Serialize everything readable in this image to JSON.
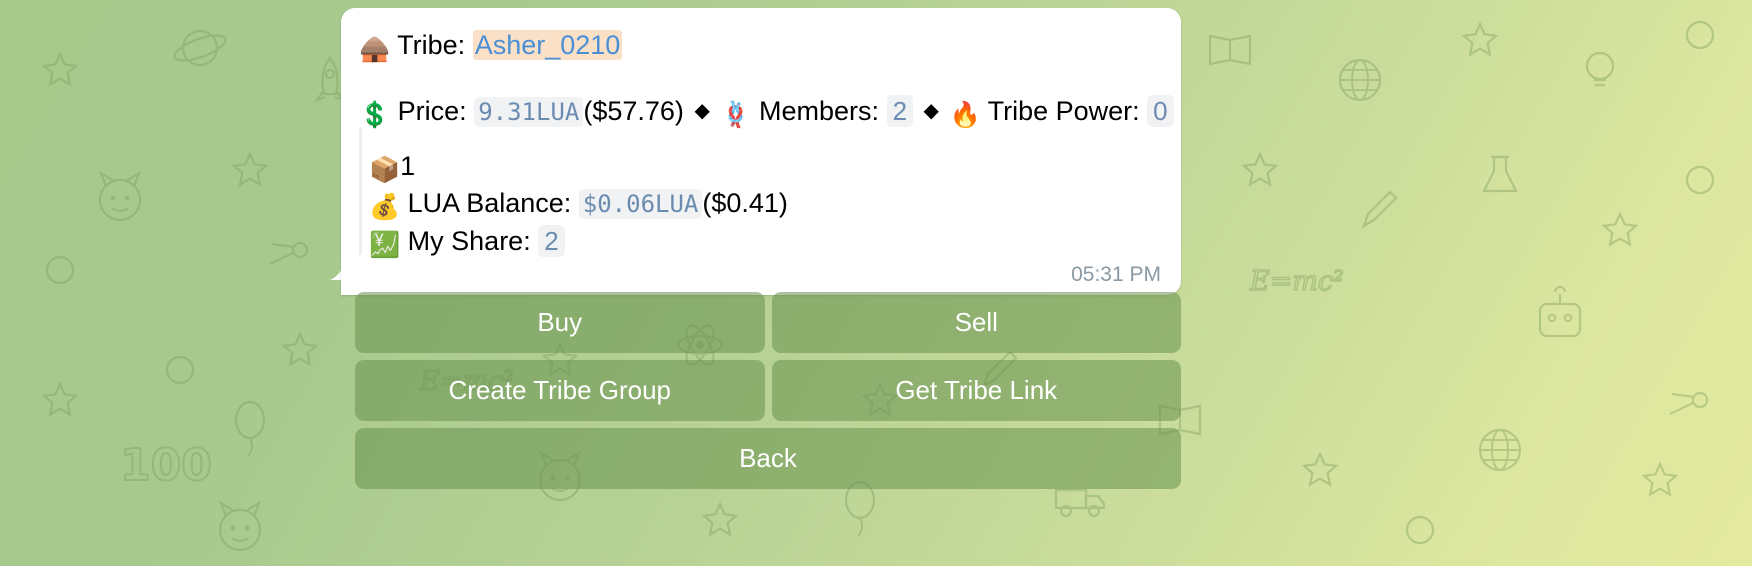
{
  "theme": {
    "bubble_bg": "#ffffff",
    "mention_color": "#4a8fd6",
    "mention_highlight": "#fbe0c8",
    "code_color": "#6b8cb0",
    "code_bg": "#f1f2f4",
    "button_bg": "rgba(104,146,79,0.55)",
    "button_text": "#ffffff",
    "time_color": "#8a9aa4"
  },
  "message": {
    "tribe": {
      "icon": "hut-emoji",
      "emoji": "🛖",
      "label": "Tribe:",
      "name": "Asher_0210"
    },
    "stats": {
      "price": {
        "icon": "dollar-emoji",
        "emoji": "💲",
        "label": "Price:",
        "value": "9.31LUA",
        "usd": "($57.76)"
      },
      "separator": "◆",
      "members": {
        "icon": "knot-emoji",
        "emoji": "🪢",
        "label": "Members:",
        "value": "2"
      },
      "tribe_power": {
        "icon": "fire-emoji",
        "emoji": "🔥",
        "label": "Tribe Power:",
        "value": "0"
      }
    },
    "quote": {
      "package": {
        "icon": "package-emoji",
        "emoji": "📦",
        "value": "1"
      },
      "lua_balance": {
        "icon": "money-bag-emoji",
        "emoji": "💰",
        "label": "LUA Balance:",
        "value": "$0.06LUA",
        "usd": "($0.41)"
      },
      "my_share": {
        "icon": "chart-increasing-yen-emoji",
        "emoji": "💹",
        "label": "My Share:",
        "value": "2"
      }
    },
    "time": "05:31 PM"
  },
  "keyboard": {
    "rows": [
      [
        {
          "label": "Buy",
          "name": "buy-button"
        },
        {
          "label": "Sell",
          "name": "sell-button"
        }
      ],
      [
        {
          "label": "Create Tribe Group",
          "name": "create-tribe-group-button"
        },
        {
          "label": "Get Tribe Link",
          "name": "get-tribe-link-button"
        }
      ],
      [
        {
          "label": "Back",
          "name": "back-button"
        }
      ]
    ]
  }
}
